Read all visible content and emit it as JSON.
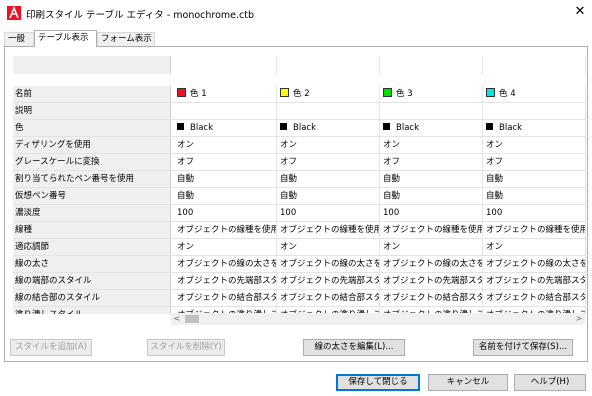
{
  "window": {
    "title": "印刷スタイル テーブル エディタ - monochrome.ctb",
    "close_glyph": "✕"
  },
  "tabs": [
    {
      "label": "一般",
      "active": false
    },
    {
      "label": "テーブル表示",
      "active": true
    },
    {
      "label": "フォーム表示",
      "active": false
    }
  ],
  "table": {
    "row_labels": [
      "名前",
      "説明",
      "色",
      "ディザリングを使用",
      "グレースケールに変換",
      "割り当てられたペン番号を使用",
      "仮想ペン番号",
      "濃淡度",
      "線種",
      "適応調節",
      "線の太さ",
      "線の端部のスタイル",
      "線の結合部のスタイル",
      "塗り潰しスタイル"
    ],
    "columns": [
      {
        "name": "色 1",
        "swatch": "#e81224",
        "desc": "",
        "color": "Black",
        "dither": "オン",
        "gray": "オフ",
        "pen": "自動",
        "vpen": "自動",
        "screen": "100",
        "linetype": "オブジェクトの線種を使用",
        "adaptive": "オン",
        "weight": "オブジェクトの線の太さを使",
        "endstyle": "オブジェクトの先端部スタイ",
        "joinstyle": "オブジェクトの結合部スタイ",
        "fill": "オブジェクトの塗り潰しスタ"
      },
      {
        "name": "色 2",
        "swatch": "#ffff00",
        "desc": "",
        "color": "Black",
        "dither": "オン",
        "gray": "オフ",
        "pen": "自動",
        "vpen": "自動",
        "screen": "100",
        "linetype": "オブジェクトの線種を使用",
        "adaptive": "オン",
        "weight": "オブジェクトの線の太さを使",
        "endstyle": "オブジェクトの先端部スタイ",
        "joinstyle": "オブジェクトの結合部スタイ",
        "fill": "オブジェクトの塗り潰しスタ"
      },
      {
        "name": "色 3",
        "swatch": "#00e000",
        "desc": "",
        "color": "Black",
        "dither": "オン",
        "gray": "オフ",
        "pen": "自動",
        "vpen": "自動",
        "screen": "100",
        "linetype": "オブジェクトの線種を使用",
        "adaptive": "オン",
        "weight": "オブジェクトの線の太さを使",
        "endstyle": "オブジェクトの先端部スタイ",
        "joinstyle": "オブジェクトの結合部スタイ",
        "fill": "オブジェクトの塗り潰しスタ"
      },
      {
        "name": "色 4",
        "swatch": "#00e5e5",
        "desc": "",
        "color": "Black",
        "dither": "オン",
        "gray": "オフ",
        "pen": "自動",
        "vpen": "自動",
        "screen": "100",
        "linetype": "オブジェクトの線種を使用",
        "adaptive": "オン",
        "weight": "オブジェクトの線の太さを使",
        "endstyle": "オブジェクトの先端部スタイ",
        "joinstyle": "オブジェクトの結合部スタイ",
        "fill": "オブジェクトの塗り潰しスタ"
      }
    ]
  },
  "scrollbar": {
    "left_arrow": "<",
    "right_arrow": ">"
  },
  "buttons": {
    "add_style": "スタイルを追加(A)",
    "delete_style": "スタイルを削除(Y)",
    "edit_lineweights": "線の太さを編集(L)...",
    "save_as": "名前を付けて保存(S)...",
    "save_close": "保存して閉じる",
    "cancel": "キャンセル",
    "help": "ヘルプ(H)"
  },
  "colors": {
    "accent": "#0078d7",
    "app_icon": "#e81224"
  }
}
